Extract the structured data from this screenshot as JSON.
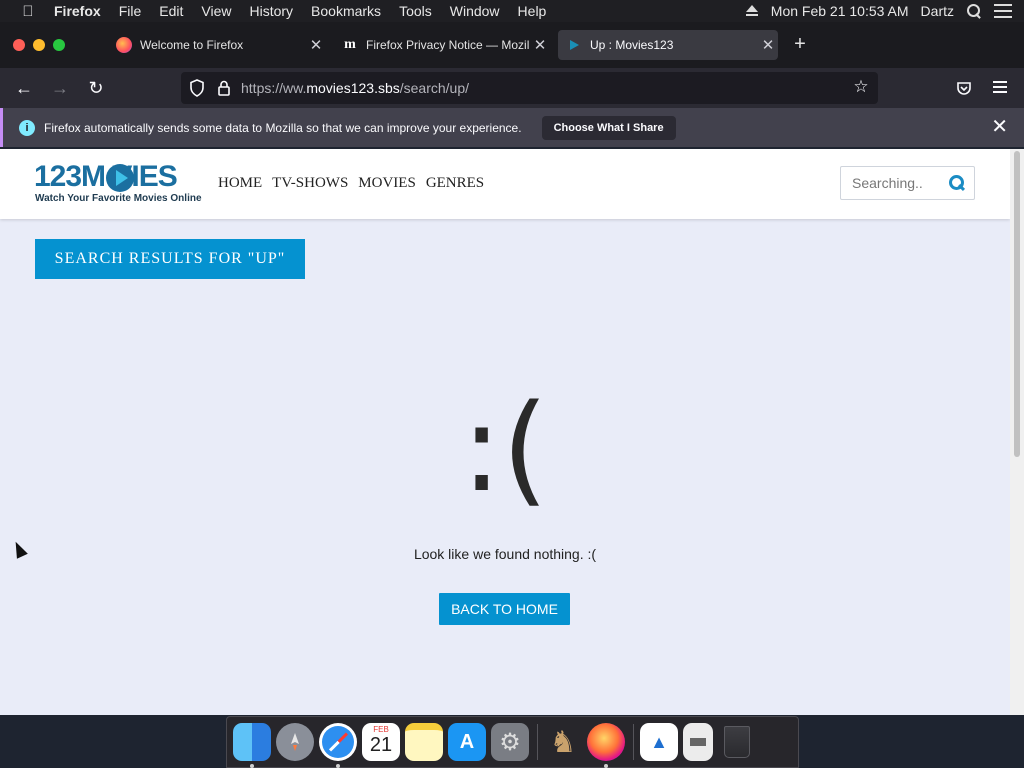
{
  "menubar": {
    "app": "Firefox",
    "items": [
      "File",
      "Edit",
      "View",
      "History",
      "Bookmarks",
      "Tools",
      "Window",
      "Help"
    ],
    "datetime": "Mon Feb 21  10:53 AM",
    "user": "Dartz"
  },
  "tabs": [
    {
      "label": "Welcome to Firefox",
      "icon": "firefox-icon"
    },
    {
      "label": "Firefox Privacy Notice — Mozilla",
      "icon": "mozilla-m-icon"
    },
    {
      "label": "Up : Movies123",
      "icon": "play-icon"
    }
  ],
  "urlbar": {
    "url_prefix": "https://ww.",
    "url_domain": "movies123.sbs",
    "url_path": "/search/up/"
  },
  "notification": {
    "message": "Firefox automatically sends some data to Mozilla so that we can improve your experience.",
    "button": "Choose What I Share"
  },
  "site": {
    "logo_text": "123M VIES",
    "tagline": "Watch Your Favorite Movies Online",
    "nav": [
      "HOME",
      "TV-SHOWS",
      "MOVIES",
      "GENRES"
    ],
    "search_placeholder": "Searching..",
    "results_title": "SEARCH RESULTS FOR \"UP\"",
    "sad_face": ":(",
    "empty_message": "Look like we found nothing. :(",
    "back_button": "BACK TO HOME"
  },
  "dock": {
    "apps": [
      "finder-icon",
      "launchpad-icon",
      "safari-icon",
      "calendar-icon",
      "notes-icon",
      "app-store-icon",
      "system-preferences-icon",
      "chess-icon",
      "firefox-icon",
      "preview-icon",
      "file-icon",
      "trash-icon"
    ],
    "calendar_month": "FEB",
    "calendar_day": "21"
  },
  "colors": {
    "accent": "#0592d0",
    "notification_border": "#c58df5",
    "page_bg": "#e9ecf8"
  }
}
